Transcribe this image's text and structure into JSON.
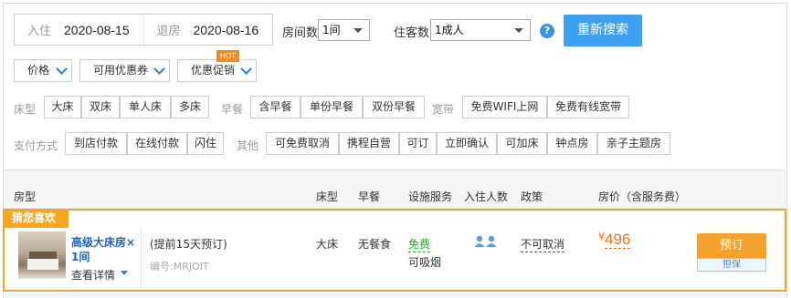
{
  "search": {
    "checkin_label": "入住",
    "checkin_value": "2020-08-15",
    "checkout_label": "退房",
    "checkout_value": "2020-08-16",
    "rooms_label": "房间数",
    "rooms_value": "1间",
    "guests_label": "住客数",
    "guests_value": "1成人",
    "help_icon_text": "?",
    "research_label": "重新搜索"
  },
  "filters_dropdowns": {
    "price": "价格",
    "coupons": "可用优惠券",
    "promotions": "优惠促销",
    "hot_badge": "HOT"
  },
  "filter_rows": {
    "bed_label": "床型",
    "bed_options": [
      "大床",
      "双床",
      "单人床",
      "多床"
    ],
    "breakfast_label": "早餐",
    "breakfast_options": [
      "含早餐",
      "单份早餐",
      "双份早餐"
    ],
    "broadband_label": "宽带",
    "broadband_options": [
      "免费WIFI上网",
      "免费有线宽带"
    ],
    "payment_label": "支付方式",
    "payment_options": [
      "到店付款",
      "在线付款",
      "闪住"
    ],
    "other_label": "其他",
    "other_options": [
      "可免费取消",
      "携程自营",
      "可订",
      "立即确认",
      "可加床",
      "钟点房",
      "亲子主题房"
    ]
  },
  "table_header": {
    "room_type": "房型",
    "bed": "床型",
    "breakfast": "早餐",
    "facilities": "设施服务",
    "occupancy": "入住人数",
    "policy": "政策",
    "price": "房价（含服务费）"
  },
  "room": {
    "guess_badge": "猜您喜欢",
    "name_line1": "高级大床房",
    "name_close": "×",
    "name_line2": "1间",
    "details_link": "查看详情",
    "advance_note": "(提前15天预订)",
    "code": "编号:MRJOIT",
    "bed": "大床",
    "breakfast": "无餐食",
    "facility_free": "免费",
    "facility_smoke": "可吸烟",
    "policy": "不可取消",
    "currency": "¥",
    "price": "496",
    "book_label": "预订",
    "guarantee_label": "担保"
  },
  "colors": {
    "accent_blue": "#3fa0f0",
    "orange": "#f5a623",
    "price_orange": "#f2711c",
    "free_green": "#2aa52a"
  }
}
